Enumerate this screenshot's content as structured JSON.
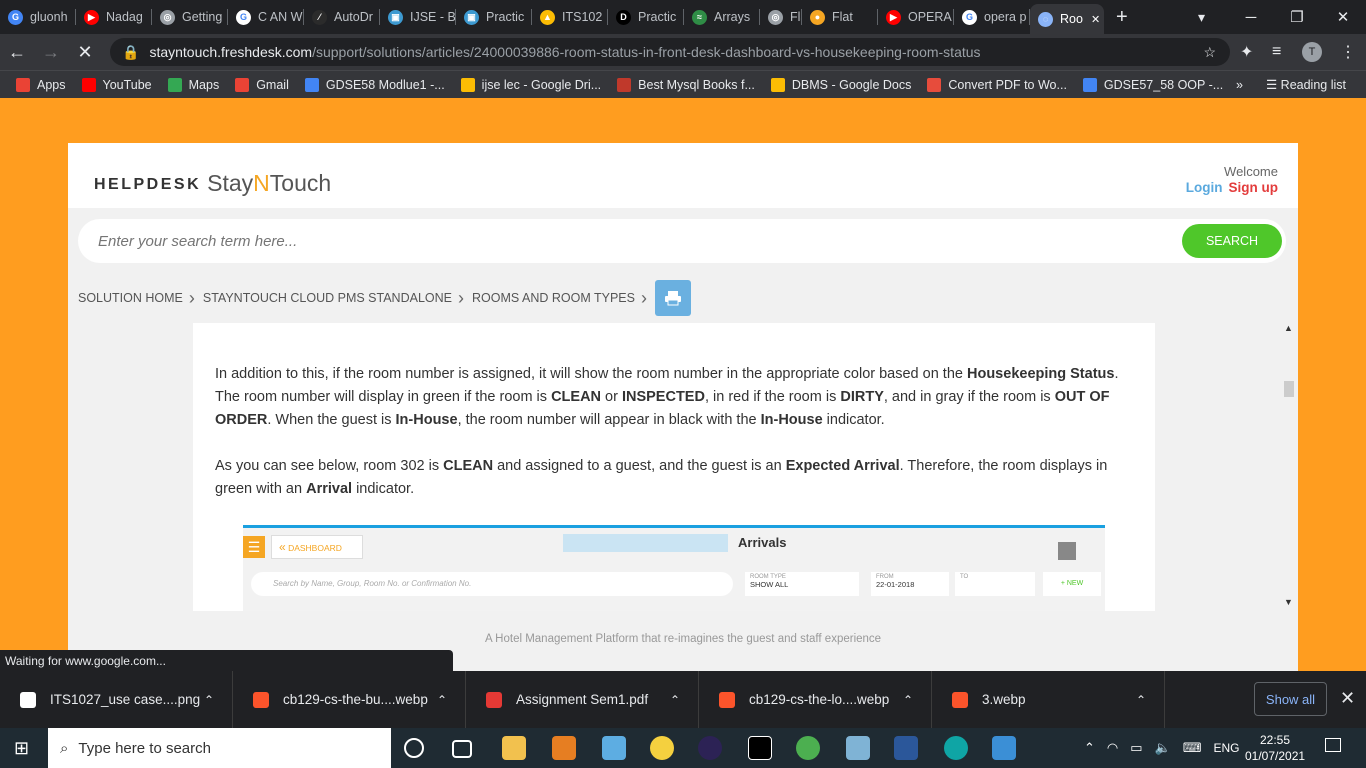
{
  "browser": {
    "tabs": [
      {
        "label": "gluonh",
        "color": "#4285f4",
        "glyph": "G"
      },
      {
        "label": "Nadag",
        "color": "#ff0000",
        "glyph": "▶"
      },
      {
        "label": "Getting",
        "color": "#9aa0a6",
        "glyph": "◎"
      },
      {
        "label": "C AN W",
        "color": "#fff",
        "glyph": "G"
      },
      {
        "label": "AutoDr",
        "color": "#2b2b2b",
        "glyph": "⁄"
      },
      {
        "label": "IJSE - B",
        "color": "#3d9ad1",
        "glyph": "▣"
      },
      {
        "label": "Practic",
        "color": "#3d9ad1",
        "glyph": "▣"
      },
      {
        "label": "ITS102",
        "color": "#fbbc04",
        "glyph": "▲"
      },
      {
        "label": "Practic",
        "color": "#000",
        "glyph": "D"
      },
      {
        "label": "Arrays",
        "color": "#2f8d46",
        "glyph": "≈"
      },
      {
        "label": "Flat",
        "color": "#9aa0a6",
        "glyph": "◎"
      },
      {
        "label": "Flat",
        "color": "#f5a623",
        "glyph": "●"
      },
      {
        "label": "OPERA",
        "color": "#ff0000",
        "glyph": "▶"
      },
      {
        "label": "opera p",
        "color": "#fff",
        "glyph": "G"
      },
      {
        "label": "Roo",
        "color": "#8ab4f8",
        "glyph": "◌"
      }
    ],
    "url_host": "stayntouch.freshdesk.com",
    "url_path": "/support/solutions/articles/24000039886-room-status-in-front-desk-dashboard-vs-housekeeping-room-status",
    "avatar": "T",
    "bookmarks": [
      {
        "label": "Apps",
        "color": "#ea4335"
      },
      {
        "label": "YouTube",
        "color": "#ff0000"
      },
      {
        "label": "Maps",
        "color": "#34a853"
      },
      {
        "label": "Gmail",
        "color": "#ea4335"
      },
      {
        "label": "GDSE58 Modlue1 -...",
        "color": "#4285f4"
      },
      {
        "label": "ijse lec - Google Dri...",
        "color": "#fbbc04"
      },
      {
        "label": "Best Mysql Books f...",
        "color": "#c0392b"
      },
      {
        "label": "DBMS - Google Docs",
        "color": "#fbbc04"
      },
      {
        "label": "Convert PDF to Wo...",
        "color": "#e74c3c"
      },
      {
        "label": "GDSE57_58 OOP -...",
        "color": "#4285f4"
      }
    ],
    "bm_more": "»",
    "reading_list": "Reading list"
  },
  "page": {
    "logo_left": "HELPDESK",
    "logo_a": "Stay",
    "logo_n": "N",
    "logo_b": "Touch",
    "welcome": "Welcome",
    "login": "Login",
    "signup": "Sign up",
    "search_placeholder": "Enter your search term here...",
    "search_btn": "SEARCH",
    "crumbs": [
      "SOLUTION HOME",
      "STAYNTOUCH CLOUD PMS STANDALONE",
      "ROOMS AND ROOM TYPES"
    ],
    "footer": "A Hotel Management Platform that re-imagines the guest and staff experience"
  },
  "article": {
    "p1_a": "In addition to this, if the room number is assigned, it will show the room number in the appropriate color based on the ",
    "p1_b": "Housekeeping Status",
    "p1_c": ". The room number will display in green if the room is ",
    "p1_d": "CLEAN",
    "p1_e": " or ",
    "p1_f": "INSPECTED",
    "p1_g": ", in red if the room is ",
    "p1_h": "DIRTY",
    "p1_i": ", and in gray if the room is ",
    "p1_j": "OUT OF ORDER",
    "p1_k": ". When the guest is ",
    "p1_l": "In-House",
    "p1_m": ", the room number will appear in black with the ",
    "p1_n": "In-House",
    "p1_o": " indicator.",
    "p2_a": "As you can see below, room 302 is ",
    "p2_b": "CLEAN",
    "p2_c": " and assigned to a guest, and the guest is an ",
    "p2_d": "Expected Arrival",
    "p2_e": ". Therefore, the room displays in green with an ",
    "p2_f": "Arrival",
    "p2_g": " indicator."
  },
  "embedded": {
    "dashboard": "DASHBOARD",
    "title": "Arrivals",
    "search": "Search by Name, Group, Room No. or Confirmation No.",
    "room_type_label": "ROOM TYPE",
    "room_type_value": "SHOW ALL",
    "from_label": "FROM",
    "from_value": "22-01-2018",
    "to_label": "TO",
    "new": "+ NEW"
  },
  "status": "Waiting for www.google.com...",
  "downloads": [
    {
      "name": "ITS1027_use case....png",
      "color": "#fff"
    },
    {
      "name": "cb129-cs-the-bu....webp",
      "color": "#fb542b"
    },
    {
      "name": "Assignment Sem1.pdf",
      "color": "#e53935"
    },
    {
      "name": "cb129-cs-the-lo....webp",
      "color": "#fb542b"
    },
    {
      "name": "3.webp",
      "color": "#fb542b"
    }
  ],
  "show_all": "Show all",
  "taskbar": {
    "search": "Type here to search",
    "lang": "ENG",
    "time": "22:55",
    "date": "01/07/2021"
  }
}
